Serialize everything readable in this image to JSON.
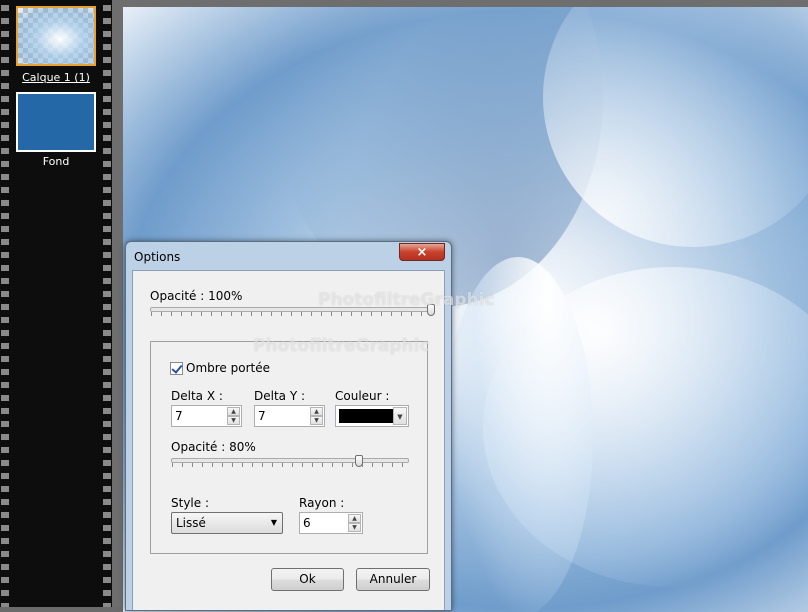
{
  "layers": {
    "items": [
      {
        "label": "Calque 1 (1)",
        "selected": true
      },
      {
        "label": "Fond",
        "selected": false,
        "color": "#2468a8"
      }
    ]
  },
  "dialog": {
    "title": "Options",
    "close_icon": "×",
    "opacity_label": "Opacité : 100%",
    "opacity_value": 100,
    "shadow": {
      "checkbox_label": "Ombre portée",
      "checked": true,
      "delta_x_label": "Delta X :",
      "delta_x_value": "7",
      "delta_y_label": "Delta Y :",
      "delta_y_value": "7",
      "color_label": "Couleur :",
      "color_value": "#000000",
      "opacity_label": "Opacité : 80%",
      "opacity_value": 80,
      "style_label": "Style :",
      "style_value": "Lissé",
      "radius_label": "Rayon :",
      "radius_value": "6"
    },
    "ok_label": "Ok",
    "cancel_label": "Annuler"
  },
  "watermark_text": "PhotofiltreGraphic",
  "icons": {
    "spin_up": "▲",
    "spin_down": "▼",
    "dropdown": "▼"
  }
}
